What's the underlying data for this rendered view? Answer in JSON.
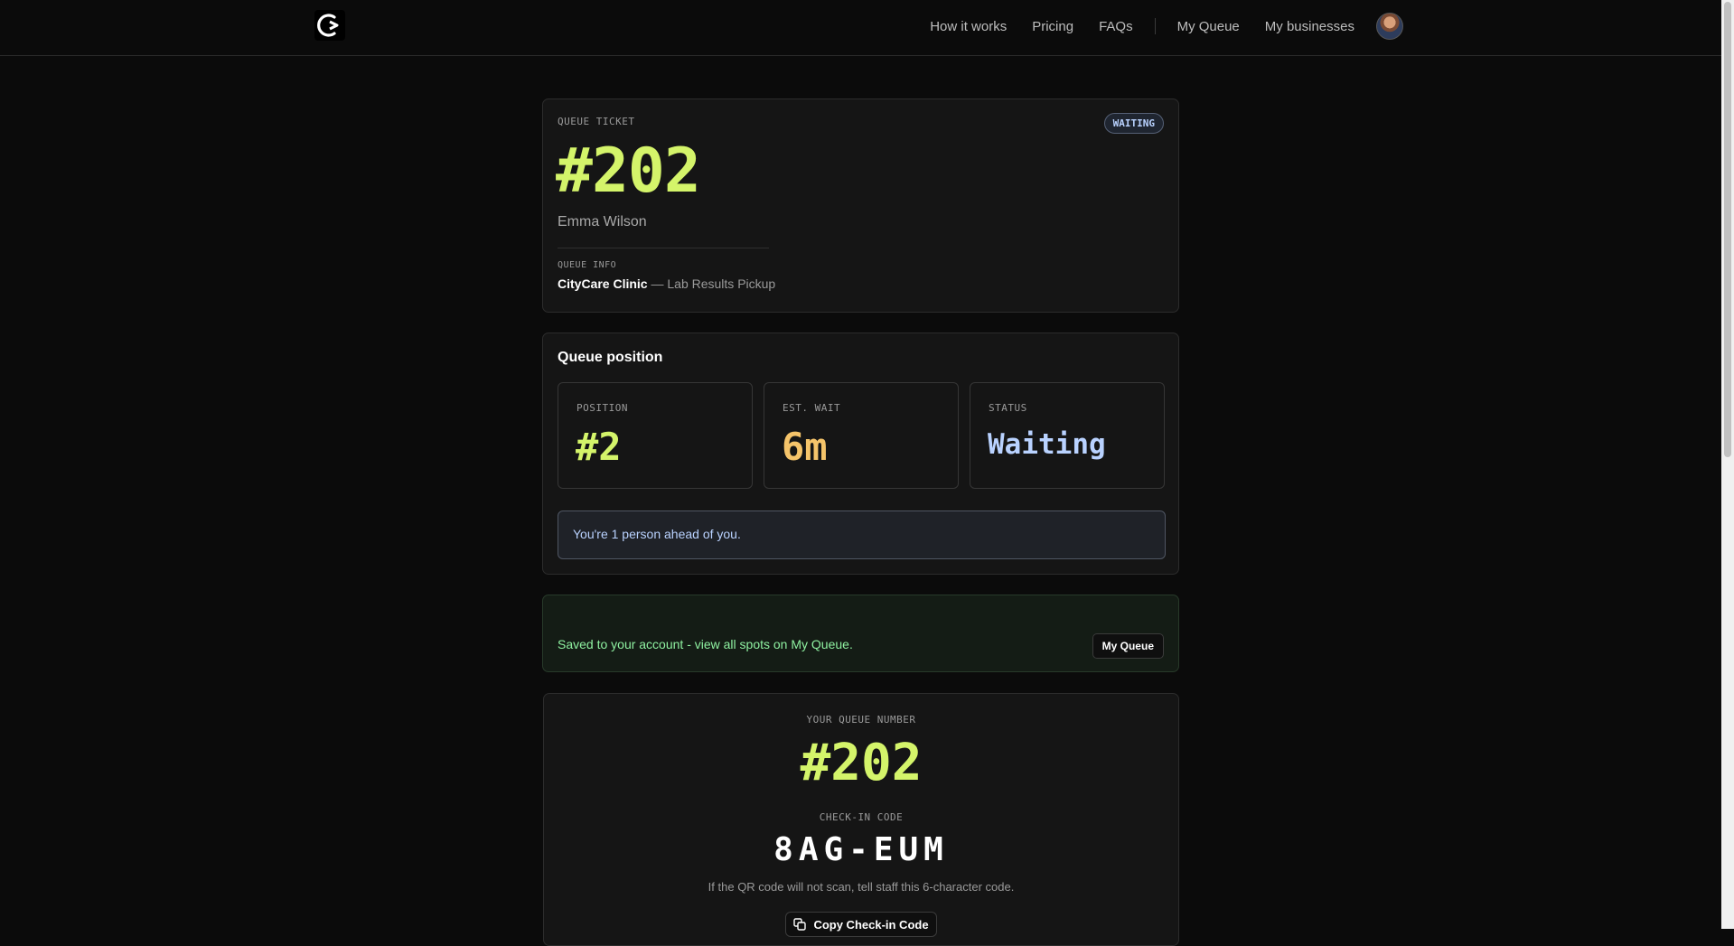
{
  "nav": {
    "links": [
      "How it works",
      "Pricing",
      "FAQs"
    ],
    "account_links": [
      "My Queue",
      "My businesses"
    ]
  },
  "ticket": {
    "label": "QUEUE TICKET",
    "number": "#202",
    "name": "Emma Wilson",
    "status_badge": "WAITING",
    "info_label": "QUEUE INFO",
    "business": "CityCare Clinic",
    "service": " — Lab Results Pickup"
  },
  "position": {
    "title": "Queue position",
    "stats": [
      {
        "label": "POSITION",
        "value": "#2"
      },
      {
        "label": "EST. WAIT",
        "value": "6m"
      },
      {
        "label": "STATUS",
        "value": "Waiting"
      }
    ],
    "notice": "You're 1 person ahead of you."
  },
  "saved": {
    "text": "Saved to your account - view all spots on My Queue.",
    "button": "My Queue"
  },
  "queue_number": {
    "label": "YOUR QUEUE NUMBER",
    "number": "#202",
    "code_label": "CHECK-IN CODE",
    "code": "8AG-EUM",
    "hint": "If the QR code will not scan, tell staff this 6-character code.",
    "copy_button": "Copy Check-in Code"
  },
  "colors": {
    "accent_lime": "#d4f46a",
    "accent_amber": "#f5c46a",
    "accent_blue": "#b9d2ff",
    "success_green": "#8ef0a0"
  }
}
